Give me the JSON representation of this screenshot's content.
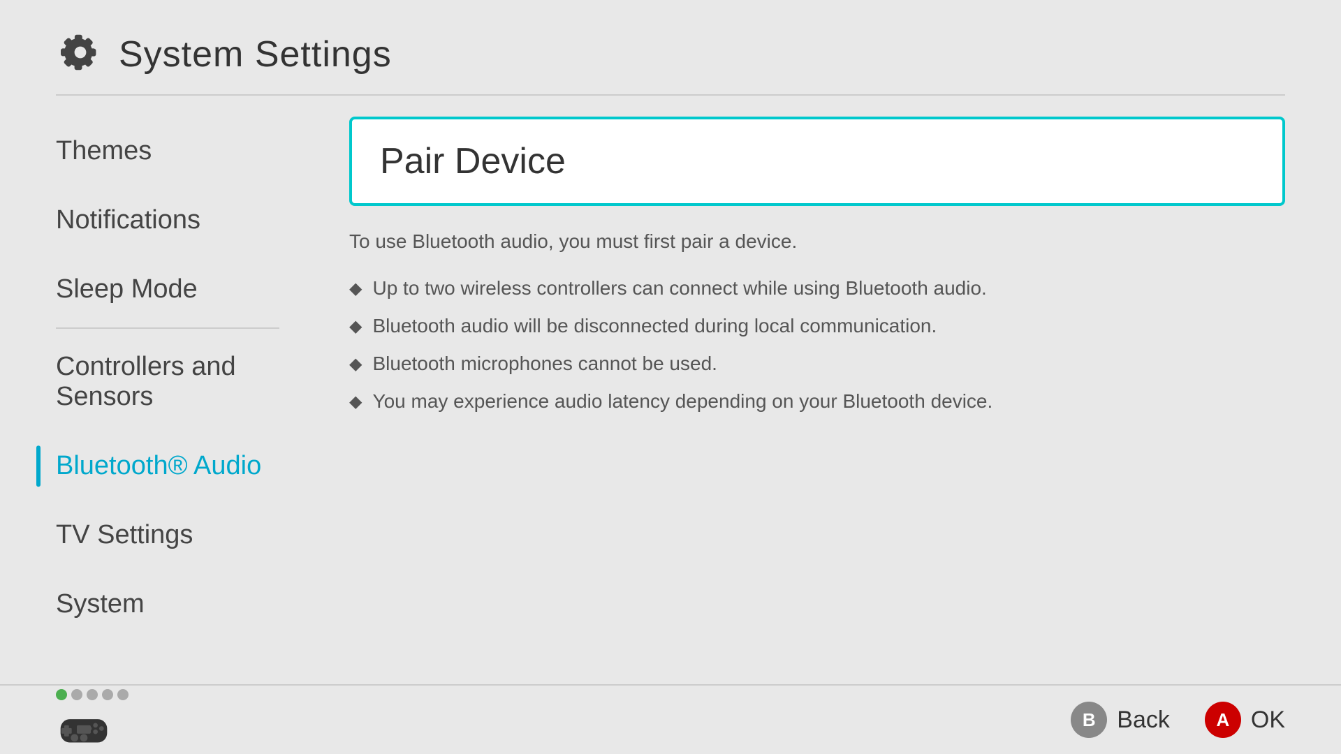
{
  "header": {
    "title": "System Settings"
  },
  "sidebar": {
    "items": [
      {
        "id": "themes",
        "label": "Themes",
        "active": false,
        "divider_after": false
      },
      {
        "id": "notifications",
        "label": "Notifications",
        "active": false,
        "divider_after": false
      },
      {
        "id": "sleep-mode",
        "label": "Sleep Mode",
        "active": false,
        "divider_after": true
      },
      {
        "id": "controllers-and-sensors",
        "label": "Controllers and Sensors",
        "active": false,
        "divider_after": false
      },
      {
        "id": "bluetooth-audio",
        "label": "Bluetooth® Audio",
        "active": true,
        "divider_after": false
      },
      {
        "id": "tv-settings",
        "label": "TV Settings",
        "active": false,
        "divider_after": false
      },
      {
        "id": "system",
        "label": "System",
        "active": false,
        "divider_after": false
      }
    ]
  },
  "main": {
    "pair_device": {
      "title": "Pair Device",
      "description": "To use Bluetooth audio, you must first pair a device.",
      "bullets": [
        "Up to two wireless controllers can connect while using Bluetooth audio.",
        "Bluetooth audio will be disconnected during local communication.",
        "Bluetooth microphones cannot be used.",
        "You may experience audio latency depending on your Bluetooth device."
      ]
    }
  },
  "footer": {
    "back_label": "Back",
    "ok_label": "OK",
    "back_button": "B",
    "ok_button": "A",
    "dots": [
      {
        "active": true
      },
      {
        "active": false
      },
      {
        "active": false
      },
      {
        "active": false
      },
      {
        "active": false
      }
    ]
  }
}
